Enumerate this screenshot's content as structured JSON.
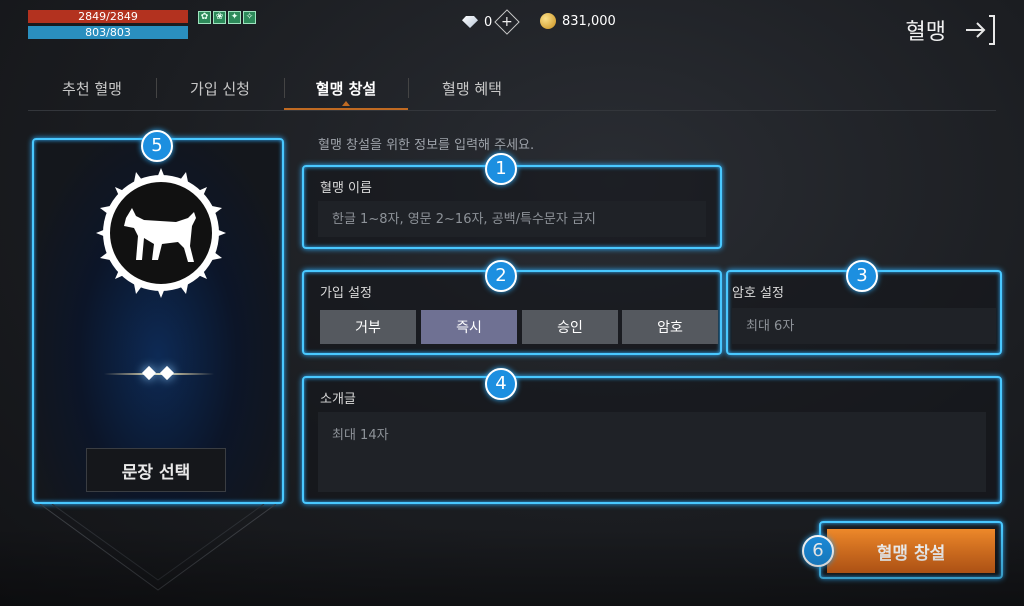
{
  "status": {
    "hp": "2849/2849",
    "mp": "803/803",
    "buffs": [
      "✿",
      "❀",
      "✦",
      "✧"
    ]
  },
  "currency": {
    "gems": "0",
    "gold": "831,000"
  },
  "header": {
    "title": "혈맹"
  },
  "tabs": [
    {
      "label": "추천 혈맹"
    },
    {
      "label": "가입 신청"
    },
    {
      "label": "혈맹 창설"
    },
    {
      "label": "혈맹 혜택"
    }
  ],
  "form": {
    "hint": "혈맹 창설을 위한 정보를 입력해 주세요.",
    "name": {
      "label": "혈맹 이름",
      "placeholder": "한글 1~8자, 영문 2~16자, 공백/특수문자 금지",
      "value": ""
    },
    "join": {
      "label": "가입 설정",
      "options": [
        "거부",
        "즉시",
        "승인",
        "암호"
      ],
      "selected": "즉시"
    },
    "password": {
      "label": "암호 설정",
      "placeholder": "최대 6자"
    },
    "intro": {
      "label": "소개글",
      "placeholder": "최대 14자"
    }
  },
  "emblem": {
    "select_label": "문장 선택",
    "icon": "dog-icon"
  },
  "create_label": "혈맹 창설",
  "badges": [
    "1",
    "2",
    "3",
    "4",
    "5",
    "6"
  ],
  "colors": {
    "highlight": "#49c8ff",
    "accent": "#e07a22",
    "badge": "#1c8fe0"
  }
}
